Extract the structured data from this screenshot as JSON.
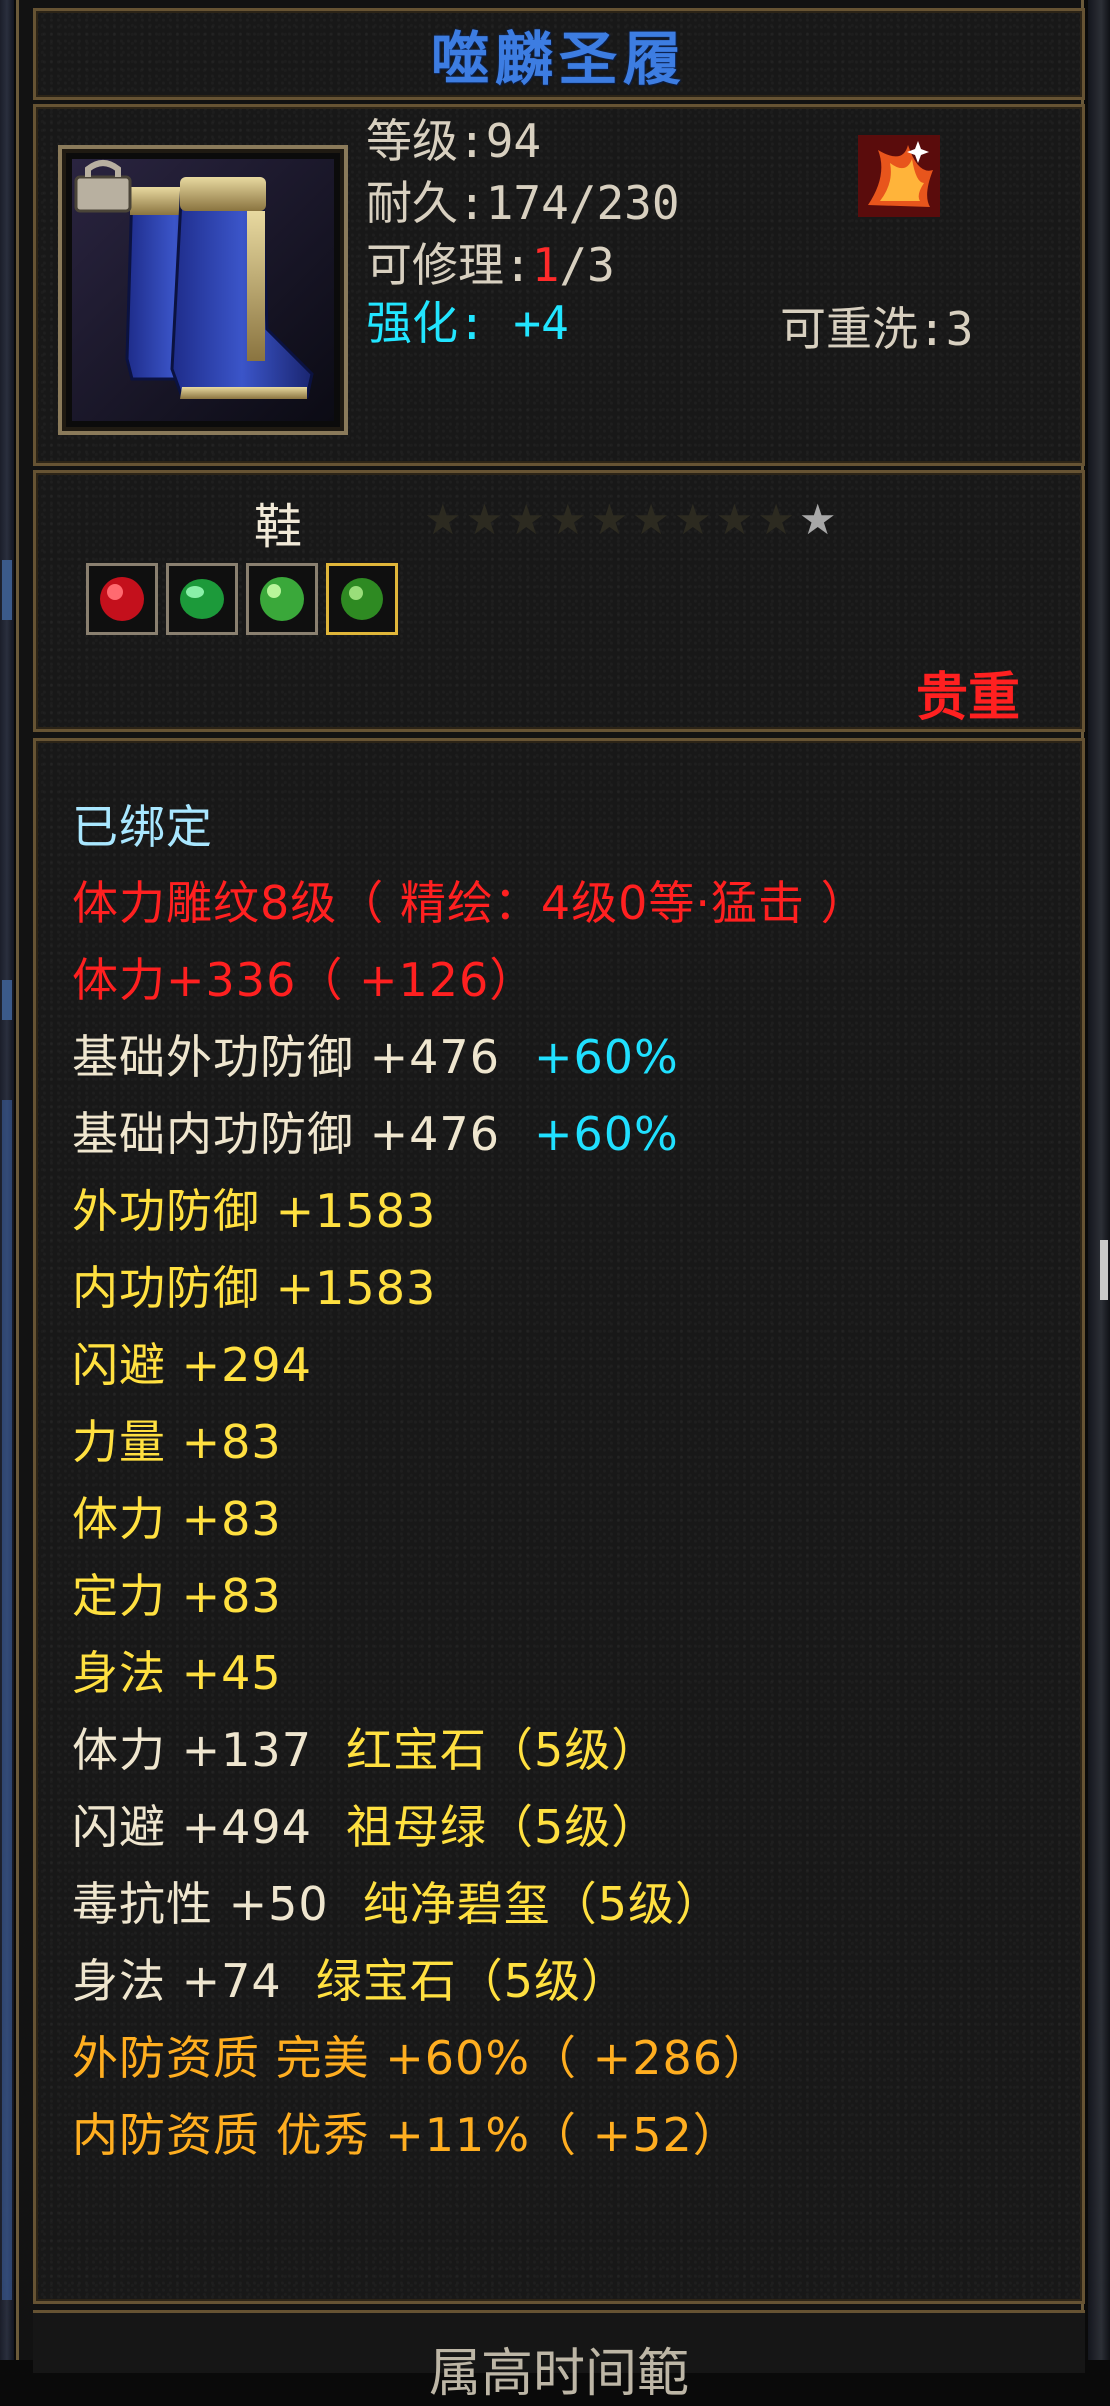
{
  "item": {
    "name": "噬麟圣履",
    "level_label": "等级:94",
    "durability_label": "耐久:174/230",
    "repair_prefix": "可修理:",
    "repair_used": "1",
    "repair_total": "/3",
    "rewash_label": "可重洗:3",
    "enhance_label": "强化: +4",
    "type": "鞋",
    "stars_total": 10,
    "stars_lit": 1,
    "rarity": "贵重",
    "gems": [
      "ruby-gem-icon",
      "emerald-gem-icon",
      "jade-gem-icon",
      "green-gem-icon"
    ]
  },
  "stats": [
    {
      "text": "已绑定",
      "color": "cyan-lt"
    },
    {
      "text": "体力雕纹8级（ 精绘：4级0等·猛击 ）",
      "color": "red"
    },
    {
      "text": "体力+336（ +126）",
      "color": "red"
    },
    {
      "text": "基础外功防御  +476",
      "extra": "+60%",
      "color": "cream"
    },
    {
      "text": "基础内功防御  +476",
      "extra": "+60%",
      "color": "cream"
    },
    {
      "text": "外功防御  +1583",
      "color": "yellow"
    },
    {
      "text": "内功防御  +1583",
      "color": "yellow"
    },
    {
      "text": "闪避  +294",
      "color": "yellow"
    },
    {
      "text": "力量  +83",
      "color": "yellow"
    },
    {
      "text": "体力  +83",
      "color": "yellow"
    },
    {
      "text": "定力  +83",
      "color": "yellow"
    },
    {
      "text": "身法  +45",
      "color": "yellow"
    },
    {
      "text": "体力  +137",
      "gem": "红宝石（5级）",
      "color": "cream"
    },
    {
      "text": "闪避  +494",
      "gem": "祖母绿（5级）",
      "color": "cream"
    },
    {
      "text": "毒抗性  +50",
      "gem": "纯净碧玺（5级）",
      "color": "cream"
    },
    {
      "text": "身法  +74",
      "gem": "绿宝石（5级）",
      "color": "cream"
    },
    {
      "text": "外防资质    完美  +60%（ +286）",
      "color": "orange"
    },
    {
      "text": "内防资质    优秀  +11%（ +52）",
      "color": "orange"
    }
  ],
  "footer": "属高时间範"
}
